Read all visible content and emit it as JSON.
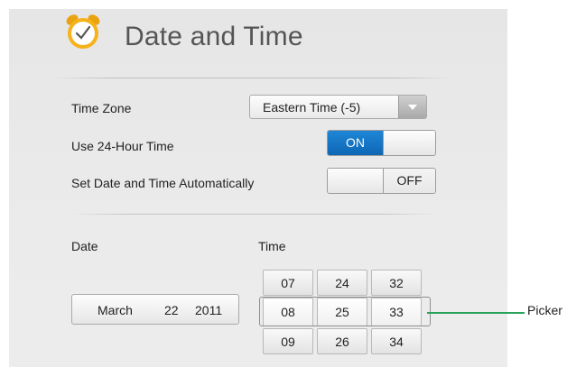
{
  "header": {
    "title": "Date and Time",
    "icon": "alarm-clock-icon"
  },
  "settings": {
    "time_zone": {
      "label": "Time Zone",
      "value": "Eastern Time (-5)"
    },
    "use_24_hour": {
      "label": "Use 24-Hour Time",
      "state": "ON"
    },
    "auto_set": {
      "label": "Set Date and Time Automatically",
      "state": "OFF"
    }
  },
  "date": {
    "label": "Date",
    "month": "March",
    "day": "22",
    "year": "2011"
  },
  "time": {
    "label": "Time",
    "columns": [
      {
        "above": "07",
        "selected": "08",
        "below": "09"
      },
      {
        "above": "24",
        "selected": "25",
        "below": "26"
      },
      {
        "above": "32",
        "selected": "33",
        "below": "34"
      }
    ]
  },
  "annotation": {
    "label": "Picker"
  },
  "colors": {
    "toggle_on": "#1470c2",
    "callout_line": "#2aa35a",
    "clock_face": "#f5b21a"
  }
}
